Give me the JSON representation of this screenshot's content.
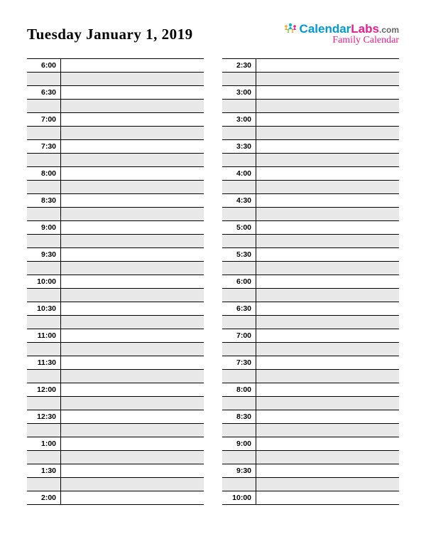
{
  "header": {
    "title": "Tuesday January 1, 2019",
    "logo": {
      "brand_a": "Calendar",
      "brand_b": "Labs",
      "domain": ".com",
      "subtitle": "Family Calendar"
    }
  },
  "columns": [
    {
      "slots": [
        {
          "time": "6:00"
        },
        {
          "time": "6:30"
        },
        {
          "time": "7:00"
        },
        {
          "time": "7:30"
        },
        {
          "time": "8:00"
        },
        {
          "time": "8:30"
        },
        {
          "time": "9:00"
        },
        {
          "time": "9:30"
        },
        {
          "time": "10:00"
        },
        {
          "time": "10:30"
        },
        {
          "time": "11:00"
        },
        {
          "time": "11:30"
        },
        {
          "time": "12:00"
        },
        {
          "time": "12:30"
        },
        {
          "time": "1:00"
        },
        {
          "time": "1:30"
        },
        {
          "time": "2:00"
        }
      ]
    },
    {
      "slots": [
        {
          "time": "2:30"
        },
        {
          "time": "3:00"
        },
        {
          "time": "3:00"
        },
        {
          "time": "3:30"
        },
        {
          "time": "4:00"
        },
        {
          "time": "4:30"
        },
        {
          "time": "5:00"
        },
        {
          "time": "5:30"
        },
        {
          "time": "6:00"
        },
        {
          "time": "6:30"
        },
        {
          "time": "7:00"
        },
        {
          "time": "7:30"
        },
        {
          "time": "8:00"
        },
        {
          "time": "8:30"
        },
        {
          "time": "9:00"
        },
        {
          "time": "9:30"
        },
        {
          "time": "10:00"
        }
      ]
    }
  ]
}
